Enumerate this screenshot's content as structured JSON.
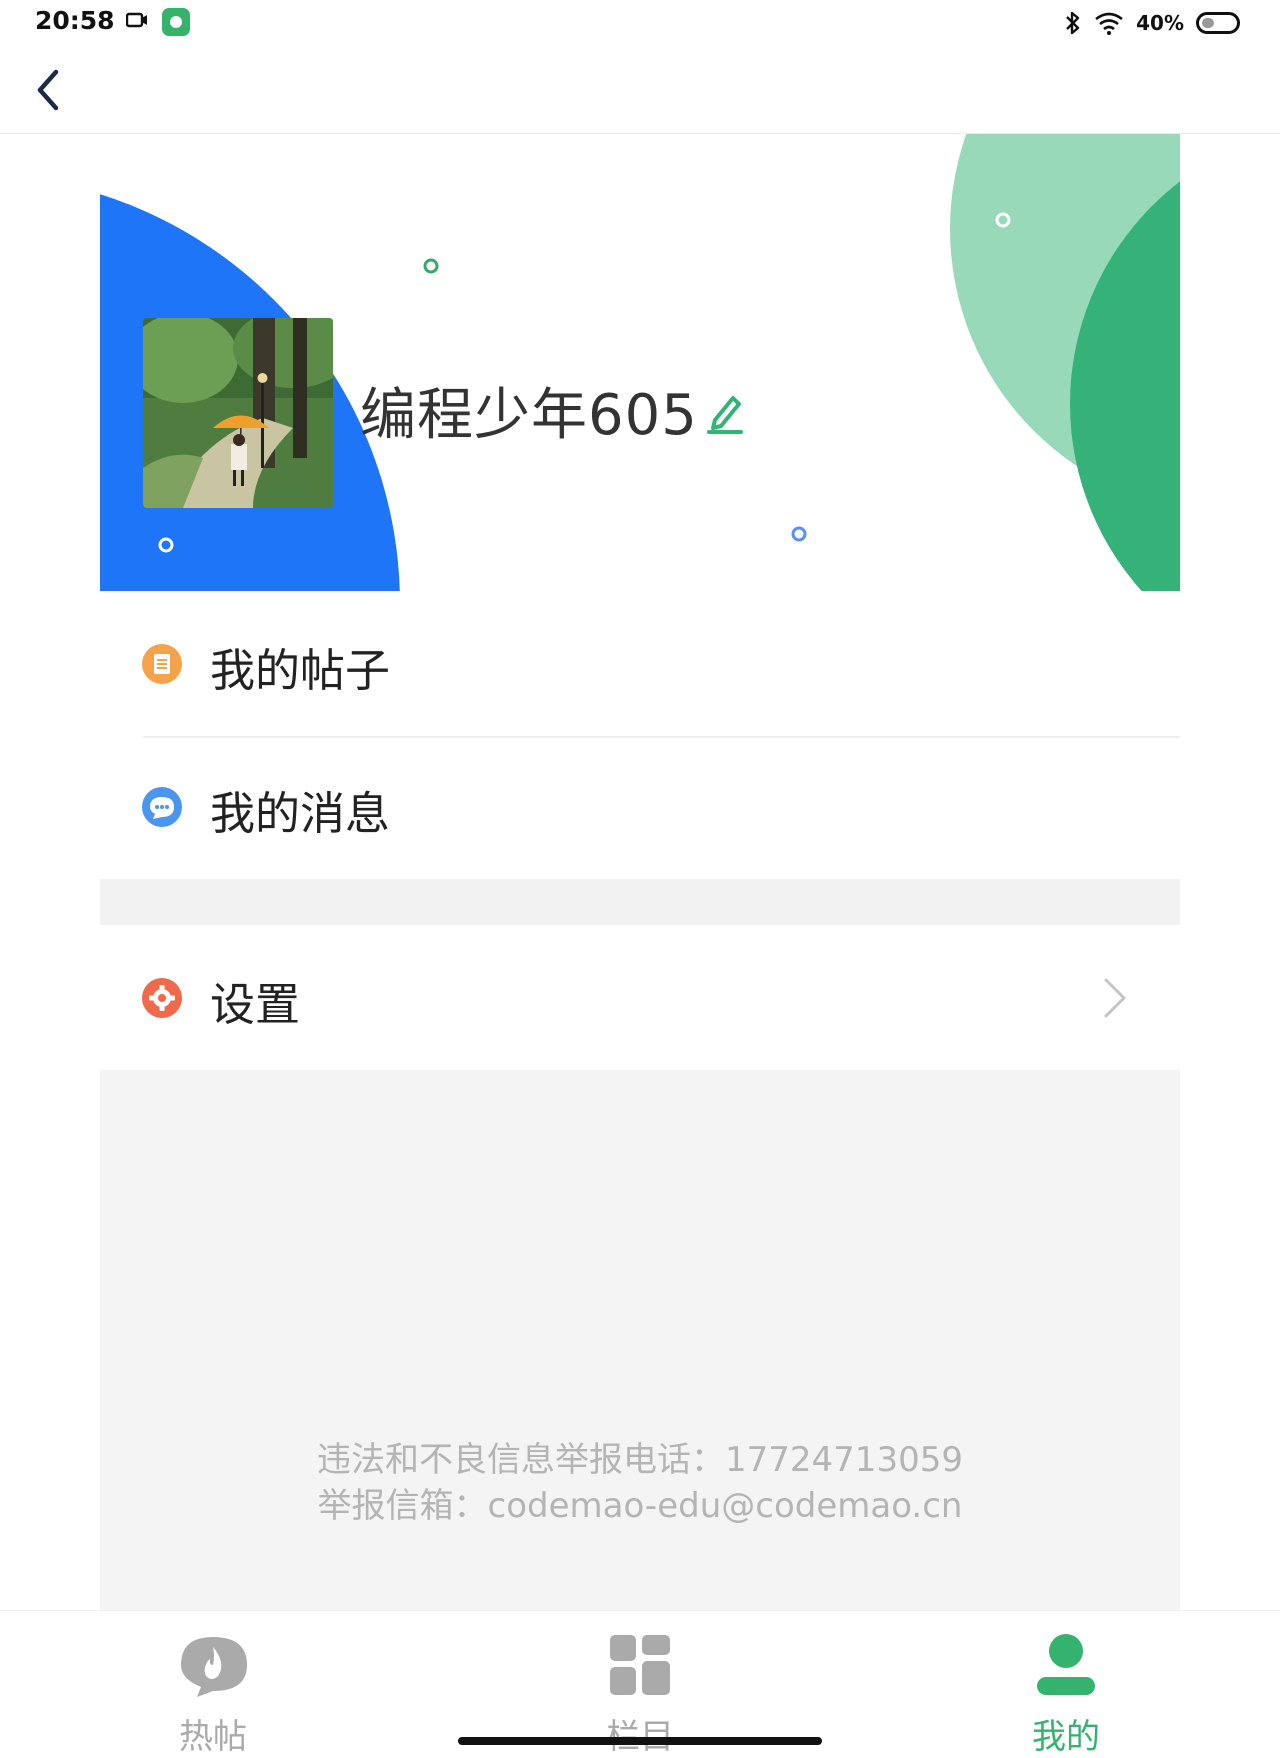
{
  "status_bar": {
    "time": "20:58",
    "battery": "40%"
  },
  "profile": {
    "username": "编程少年605"
  },
  "menu": {
    "items": [
      {
        "label": "我的帖子",
        "icon": "clipboard-icon"
      },
      {
        "label": "我的消息",
        "icon": "chat-bubble-icon"
      },
      {
        "label": "设置",
        "icon": "gear-icon"
      }
    ]
  },
  "footer": {
    "report_phone": "违法和不良信息举报电话：17724713059",
    "report_email": "举报信箱：codemao-edu@codemao.cn"
  },
  "bottom_nav": {
    "items": [
      {
        "label": "热帖",
        "icon": "flame-icon",
        "active": false
      },
      {
        "label": "栏目",
        "icon": "grid-icon",
        "active": false
      },
      {
        "label": "我的",
        "icon": "person-icon",
        "active": true
      }
    ]
  },
  "colors": {
    "accent_green": "#34b36f",
    "banner_blue": "#1e75f8",
    "banner_light_blue": "#86b3fb",
    "banner_light_green": "#98d9b9",
    "inactive_gray": "#aaaaaa"
  }
}
